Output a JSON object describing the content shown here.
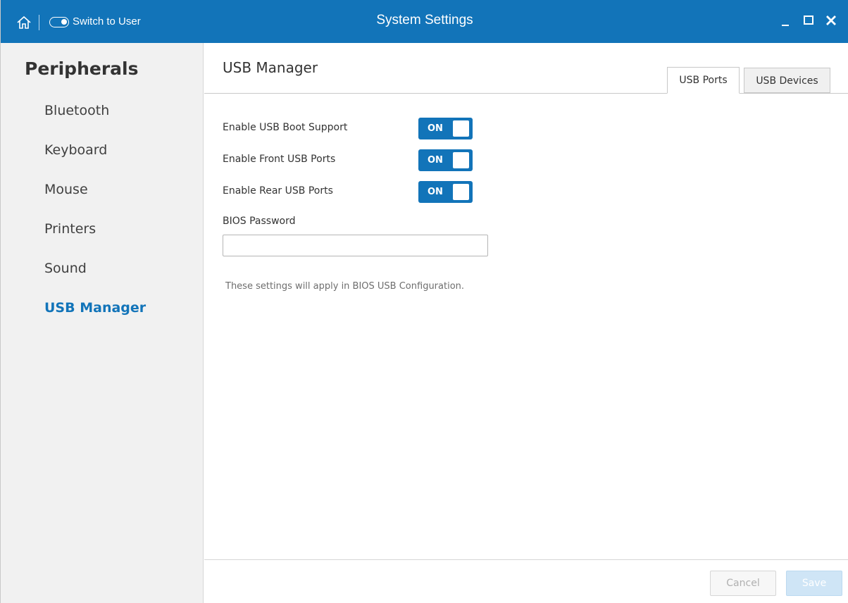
{
  "titlebar": {
    "switch_label": "Switch to User",
    "title": "System Settings",
    "icons": [
      "home-icon",
      "user-mode-toggle-icon",
      "minimize-icon",
      "maximize-icon",
      "close-icon"
    ],
    "close_glyph": "✕"
  },
  "sidebar": {
    "heading": "Peripherals",
    "items": [
      {
        "label": "Bluetooth"
      },
      {
        "label": "Keyboard"
      },
      {
        "label": "Mouse"
      },
      {
        "label": "Printers"
      },
      {
        "label": "Sound"
      },
      {
        "label": "USB Manager",
        "active": true
      }
    ]
  },
  "main": {
    "title": "USB Manager",
    "tabs": [
      {
        "label": "USB Ports",
        "selected": true
      },
      {
        "label": "USB Devices",
        "selected": false
      }
    ],
    "settings": [
      {
        "label": "Enable USB Boot Support",
        "state": "ON"
      },
      {
        "label": "Enable Front USB Ports",
        "state": "ON"
      },
      {
        "label": "Enable Rear USB Ports",
        "state": "ON"
      }
    ],
    "bios_password": {
      "label": "BIOS Password",
      "value": "",
      "placeholder": ""
    },
    "note": "These settings will apply in BIOS USB Configuration."
  },
  "footer": {
    "cancel_label": "Cancel",
    "save_label": "Save"
  },
  "colors": {
    "accent": "#1274b9",
    "sidebar_bg": "#f1f1f1",
    "save_disabled": "#cfe5f6"
  }
}
